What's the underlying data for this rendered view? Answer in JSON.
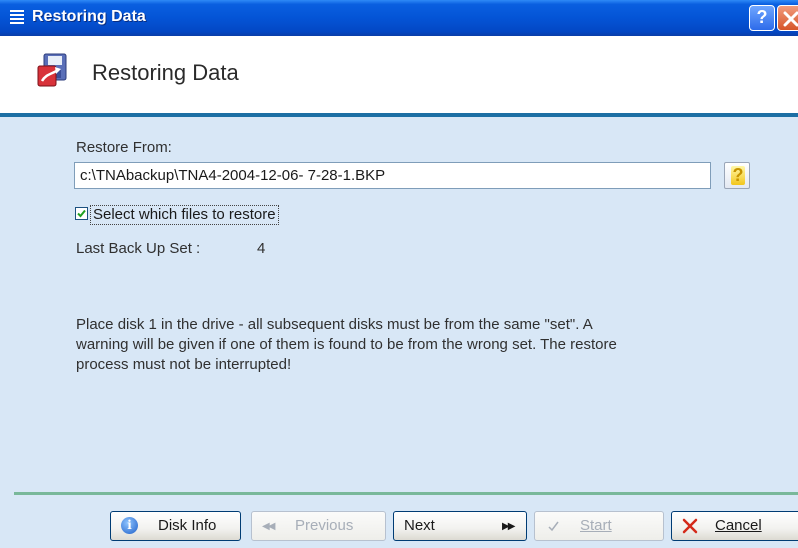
{
  "window": {
    "title": "Restoring Data",
    "help_label": "?"
  },
  "header": {
    "title": "Restoring Data"
  },
  "form": {
    "restore_from_label": "Restore From:",
    "restore_path": "c:\\TNAbackup\\TNA4-2004-12-06- 7-28-1.BKP",
    "help_button_label": "?",
    "select_files_label": "Select which files to restore",
    "select_files_checked": true,
    "last_backup_label": "Last Back Up Set :",
    "last_backup_value": "4",
    "instructions_line1": "Place disk 1 in the drive - all subsequent disks must be from the same \"set\". A",
    "instructions_line2": "warning will be given if one of them is found to be from the wrong set. The restore",
    "instructions_line3": "process must not be interrupted!"
  },
  "buttons": {
    "disk_info": {
      "label": "Disk Info",
      "enabled": true
    },
    "previous": {
      "label": "Previous",
      "enabled": false
    },
    "next": {
      "label": "Next",
      "enabled": true
    },
    "start": {
      "label": "Start",
      "enabled": false
    },
    "cancel": {
      "label": "Cancel",
      "enabled": true
    }
  },
  "icons": {
    "window": "system-menu-icon",
    "header": "restore-data-icon",
    "close": "close-icon",
    "disk_info": "info-icon",
    "previous": "double-left-arrow-icon",
    "next": "double-right-arrow-icon",
    "start": "checkmark-icon",
    "cancel": "cross-icon"
  },
  "colors": {
    "titlebar": "#0454d6",
    "body_background": "#d8e7f6",
    "header_separator": "#1c6fa4",
    "footer_separator": "#79b89a",
    "cancel_red": "#d42a1a"
  }
}
